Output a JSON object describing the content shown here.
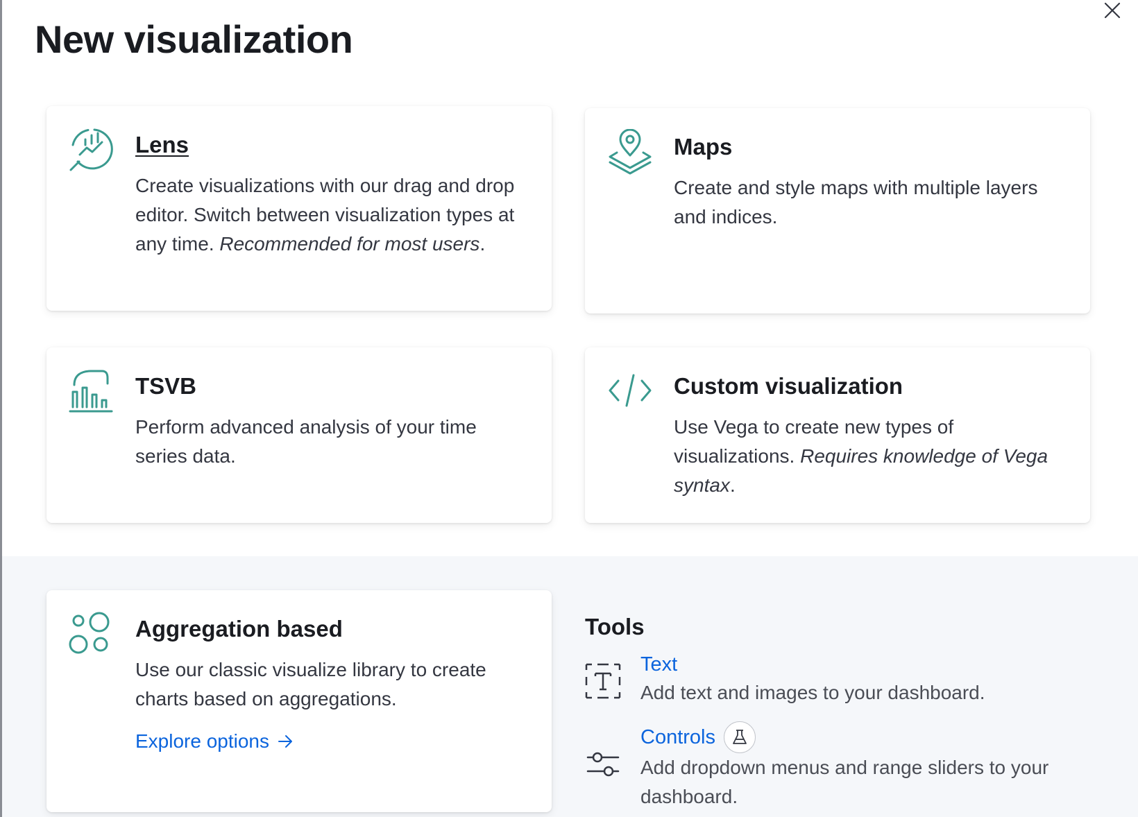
{
  "title": "New visualization",
  "cards": {
    "lens": {
      "title": "Lens",
      "desc": "Create visualizations with our drag and drop editor. Switch between visualization types at any time. ",
      "desc_em": "Recommended for most users",
      "desc_end": ".",
      "icon": "lens-icon"
    },
    "maps": {
      "title": "Maps",
      "desc": "Create and style maps with multiple layers and indices.",
      "icon": "maps-icon"
    },
    "tsvb": {
      "title": "TSVB",
      "desc": "Perform advanced analysis of your time series data.",
      "icon": "tsvb-icon"
    },
    "custom": {
      "title": "Custom visualization",
      "desc": "Use Vega to create new types of visualizations. ",
      "desc_em": "Requires knowledge of Vega syntax",
      "desc_end": ".",
      "icon": "code-icon"
    },
    "aggregation": {
      "title": "Aggregation based",
      "desc": "Use our classic visualize library to create charts based on aggregations.",
      "link": "Explore options",
      "icon": "circles-icon"
    }
  },
  "tools": {
    "title": "Tools",
    "items": [
      {
        "label": "Text",
        "desc": "Add text and images to your dashboard.",
        "icon": "text-icon"
      },
      {
        "label": "Controls",
        "desc": "Add dropdown menus and range sliders to your dashboard.",
        "icon": "controls-icon",
        "badge": "beaker-icon"
      }
    ]
  },
  "colors": {
    "accent_icon": "#3a9a8f",
    "link": "#0b64dd",
    "panel_bg": "#f5f7fa"
  }
}
